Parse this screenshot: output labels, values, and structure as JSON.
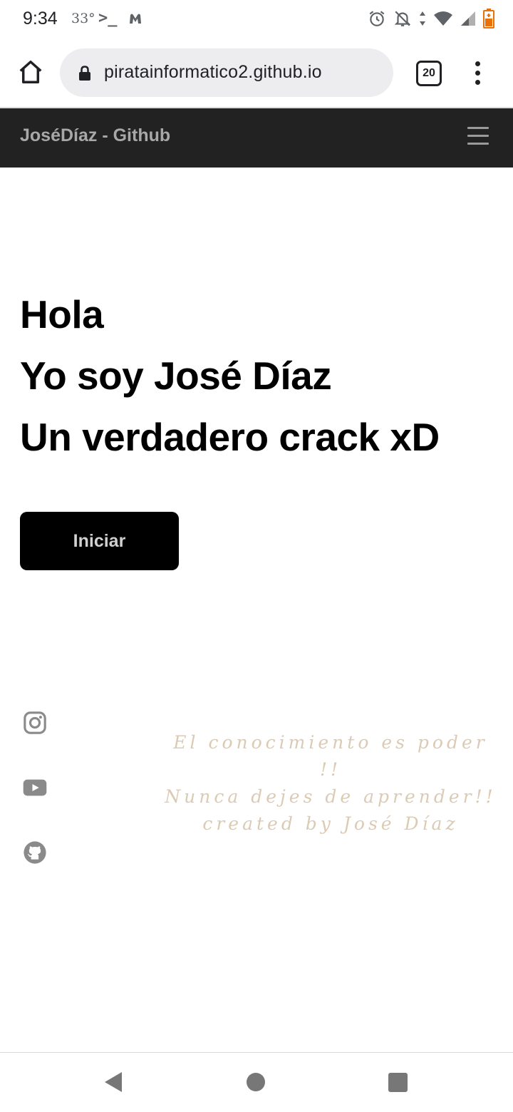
{
  "status_bar": {
    "time": "9:34",
    "temperature": "33°",
    "terminal_glyph": ">_",
    "icons": [
      "alarm-icon",
      "notifications-off-icon",
      "data-arrows-icon",
      "wifi-icon",
      "cell-signal-icon",
      "battery-low-icon"
    ]
  },
  "browser": {
    "url": "piratainformatico2.github.io",
    "tab_count": "20",
    "icons": [
      "home-icon",
      "lock-icon",
      "tabs-icon",
      "more-vert-icon"
    ]
  },
  "site_nav": {
    "brand": "JoséDíaz - Github",
    "menu_icon": "hamburger-menu-icon"
  },
  "hero": {
    "line1": "Hola",
    "line2": "Yo soy José Díaz",
    "line3": "Un verdadero crack xD",
    "button_label": "Iniciar"
  },
  "social": [
    "instagram-icon",
    "youtube-icon",
    "github-icon"
  ],
  "quote": {
    "line1": "El conocimiento es poder !!",
    "line2": "Nunca dejes de aprender!!",
    "line3": "created by José Díaz"
  },
  "android_nav": [
    "back-icon",
    "home-circle-icon",
    "recents-icon"
  ],
  "colors": {
    "navbar_bg": "#222222",
    "button_bg": "#000000",
    "quote_text": "#dccbb4",
    "url_box_bg": "#ededf0"
  }
}
